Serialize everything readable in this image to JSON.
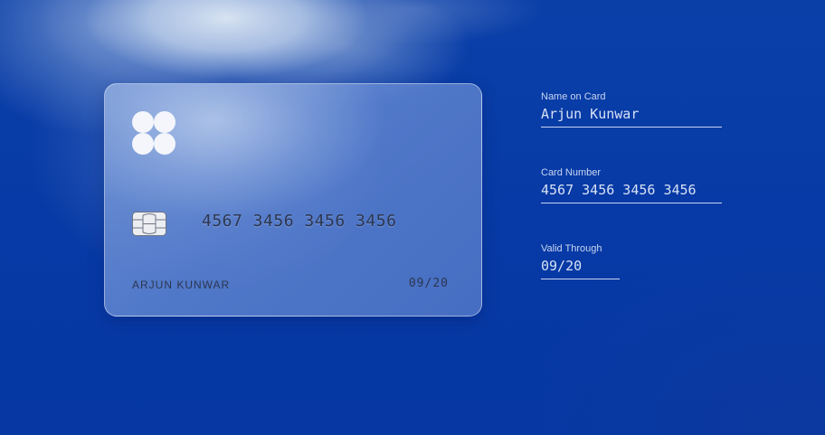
{
  "card": {
    "number": "4567 3456 3456 3456",
    "holder": "ARJUN KUNWAR",
    "expiry": "09/20"
  },
  "form": {
    "name_label": "Name on Card",
    "name_value": "Arjun Kunwar",
    "number_label": "Card Number",
    "number_value": "4567 3456 3456 3456",
    "valid_label": "Valid Through",
    "valid_value": "09/20"
  },
  "colors": {
    "background": "#073aa6",
    "card_glass": "#7b9bd8",
    "card_text": "#2c3650",
    "form_text": "#d7e1f5"
  },
  "icons": {
    "logo": "four-circles-logo-icon",
    "chip": "card-chip-icon"
  }
}
